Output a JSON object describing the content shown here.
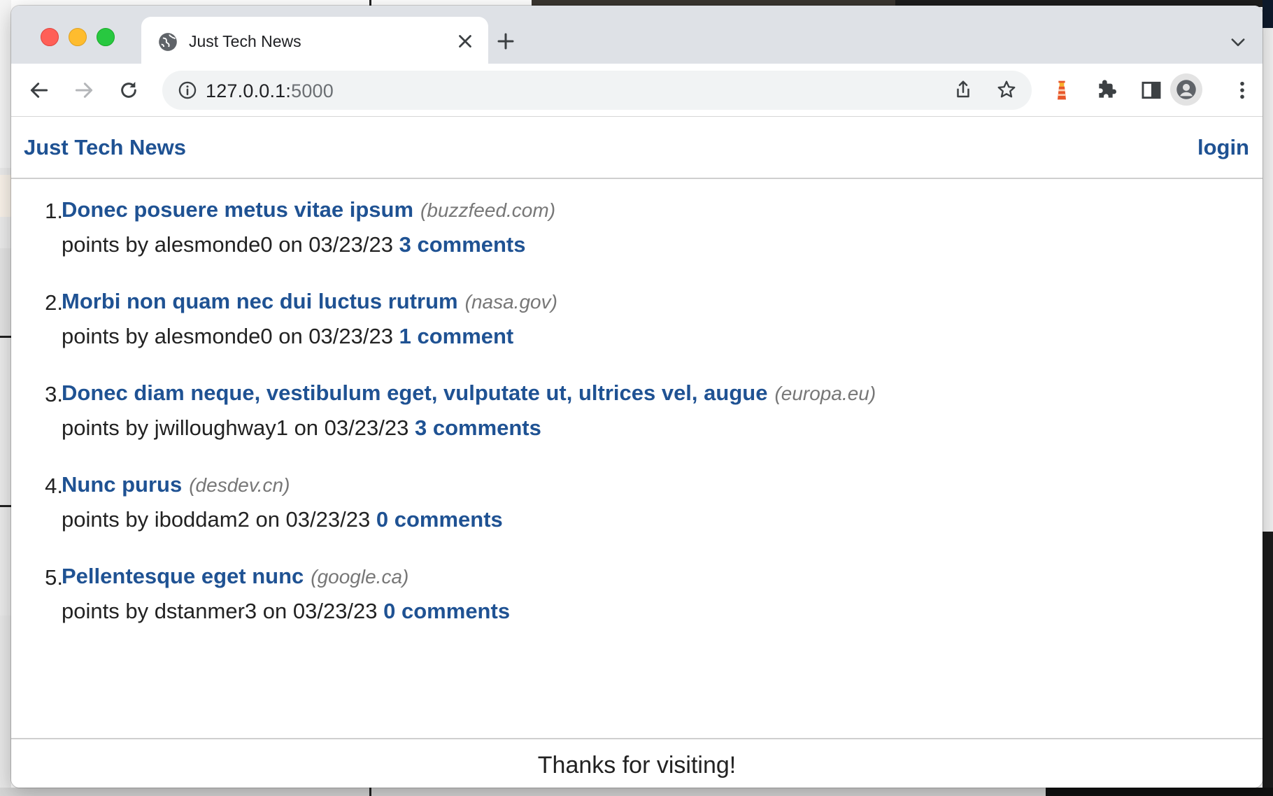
{
  "browser": {
    "tab_title": "Just Tech News",
    "url_host": "127.0.0.1:",
    "url_port": "5000"
  },
  "colors": {
    "link": "#1f5293",
    "domain_text": "#777777",
    "tabstrip_bg": "#dee1e6"
  },
  "icons": [
    "globe-icon",
    "close-icon",
    "plus-icon",
    "chevron-down-icon",
    "back-arrow-icon",
    "forward-arrow-icon",
    "reload-icon",
    "info-icon",
    "share-icon",
    "star-icon",
    "lighthouse-icon",
    "puzzle-icon",
    "sidebar-icon",
    "profile-icon",
    "more-vert-icon"
  ],
  "site": {
    "title": "Just Tech News",
    "login_label": "login",
    "footer_text": "Thanks for visiting!"
  },
  "posts": [
    {
      "num": "1.",
      "title": "Donec posuere metus vitae ipsum",
      "domain": "(buzzfeed.com)",
      "meta": "points by alesmonde0 on 03/23/23",
      "comments": "3 comments"
    },
    {
      "num": "2.",
      "title": "Morbi non quam nec dui luctus rutrum",
      "domain": "(nasa.gov)",
      "meta": "points by alesmonde0 on 03/23/23",
      "comments": "1 comment"
    },
    {
      "num": "3.",
      "title": "Donec diam neque, vestibulum eget, vulputate ut, ultrices vel, augue",
      "domain": "(europa.eu)",
      "meta": "points by jwilloughway1 on 03/23/23",
      "comments": "3 comments"
    },
    {
      "num": "4.",
      "title": "Nunc purus",
      "domain": "(desdev.cn)",
      "meta": "points by iboddam2 on 03/23/23",
      "comments": "0 comments"
    },
    {
      "num": "5.",
      "title": "Pellentesque eget nunc",
      "domain": "(google.ca)",
      "meta": "points by dstanmer3 on 03/23/23",
      "comments": "0 comments"
    }
  ]
}
